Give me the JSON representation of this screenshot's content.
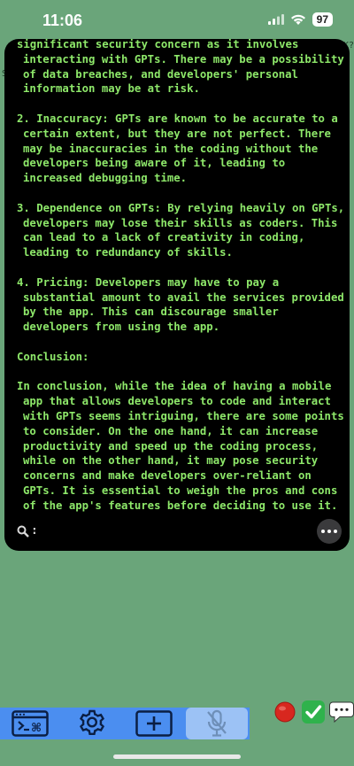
{
  "status": {
    "time": "11:06",
    "battery": "97"
  },
  "edge": {
    "left_fragment": "S",
    "right_fragment": "K?"
  },
  "terminal": {
    "paragraphs": [
      "significant security concern as it involves interacting with GPTs. There may be a possibility of data breaches, and developers' personal information may be at risk.",
      "",
      "2. Inaccuracy: GPTs are known to be accurate to a certain extent, but they are not perfect. There may be inaccuracies in the coding without the developers being aware of it, leading to increased debugging time.",
      "",
      "3. Dependence on GPTs: By relying heavily on GPTs, developers may lose their skills as coders. This can lead to a lack of creativity in coding, leading to redundancy of skills.",
      "",
      "4. Pricing: Developers may have to pay a substantial amount to avail the services provided by the app. This can discourage smaller developers from using the app.",
      "",
      "Conclusion:",
      "",
      "In conclusion, while the idea of having a mobile app that allows developers to code and interact with GPTs seems intriguing, there are some points to consider. On the one hand, it can increase productivity and speed up the coding process, while on the other hand, it may pose security concerns and make developers over-reliant on GPTs. It is essential to weigh the pros and cons of the app's features before deciding to use it."
    ],
    "prompt": ":"
  },
  "icons": {
    "terminal": "terminal-command-icon",
    "settings": "gear-icon",
    "add": "plus-box-icon",
    "mic": "mic-off-icon",
    "stop": "red-circle-icon",
    "confirm": "check-mark-icon",
    "chat": "speech-bubble-icon"
  }
}
